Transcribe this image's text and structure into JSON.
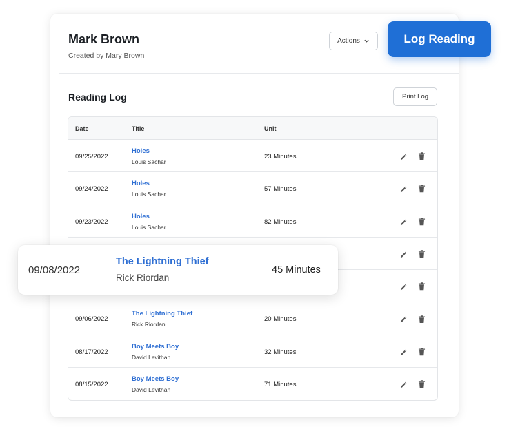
{
  "header": {
    "student_name": "Mark Brown",
    "created_by": "Created by Mary Brown",
    "actions_label": "Actions",
    "log_reading_label": "Log Reading"
  },
  "section": {
    "title": "Reading Log",
    "print_label": "Print Log"
  },
  "table": {
    "columns": [
      "Date",
      "Title",
      "Unit"
    ],
    "rows": [
      {
        "date": "09/25/2022",
        "title": "Holes",
        "author": "Louis Sachar",
        "unit": "23 Minutes"
      },
      {
        "date": "09/24/2022",
        "title": "Holes",
        "author": "Louis Sachar",
        "unit": "57 Minutes"
      },
      {
        "date": "09/23/2022",
        "title": "Holes",
        "author": "Louis Sachar",
        "unit": "82 Minutes"
      },
      {
        "date": "",
        "title": "",
        "author": "",
        "unit": ""
      },
      {
        "date": "",
        "title": "",
        "author": "",
        "unit": ""
      },
      {
        "date": "09/06/2022",
        "title": "The Lightning Thief",
        "author": "Rick Riordan",
        "unit": "20 Minutes"
      },
      {
        "date": "08/17/2022",
        "title": "Boy Meets Boy",
        "author": "David Levithan",
        "unit": "32 Minutes"
      },
      {
        "date": "08/15/2022",
        "title": "Boy Meets Boy",
        "author": "David Levithan",
        "unit": "71 Minutes"
      }
    ]
  },
  "highlight": {
    "date": "09/08/2022",
    "title": "The Lightning Thief",
    "author": "Rick Riordan",
    "unit": "45 Minutes"
  },
  "icons": {
    "edit": "pencil-icon",
    "delete": "trash-icon",
    "dropdown": "chevron-down-icon"
  },
  "colors": {
    "accent": "#1f6fd6",
    "link": "#2f6fd3"
  }
}
